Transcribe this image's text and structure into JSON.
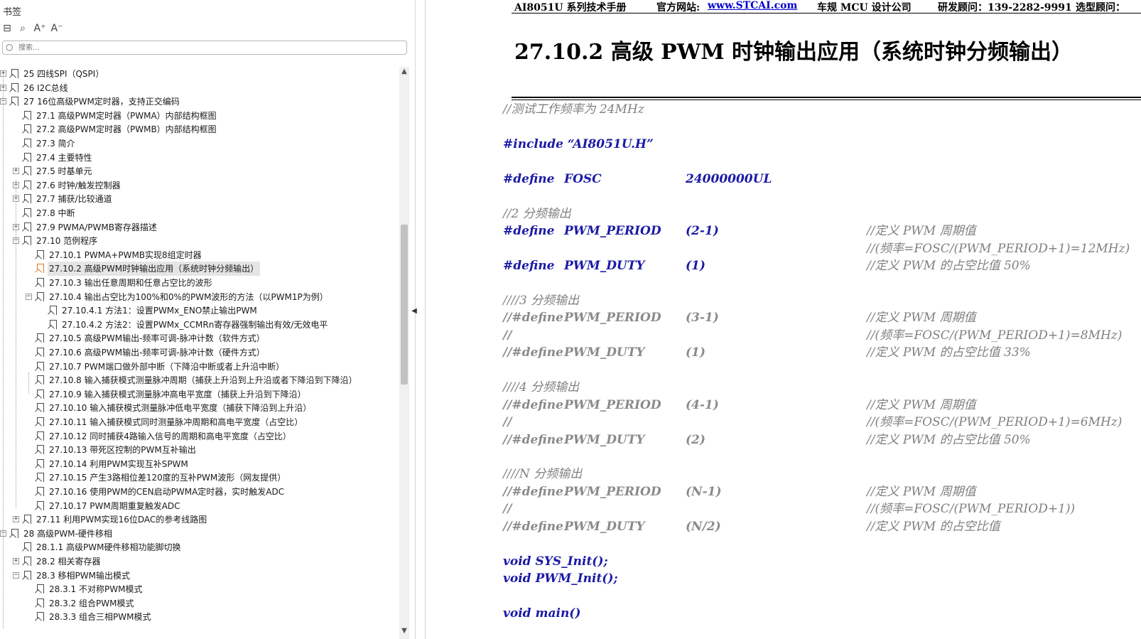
{
  "sidebar": {
    "title": "书签",
    "toolbar": {
      "icons": [
        "bookmark-list-icon",
        "bookmark-find-icon",
        "font-increase-icon",
        "font-decrease-icon"
      ],
      "glyphs": [
        "⊟",
        "⌕",
        "A⁺",
        "A⁻"
      ]
    },
    "search": {
      "placeholder": "搜索..."
    },
    "tree": [
      {
        "label": "25  四线SPI（QSPI）",
        "level": 0,
        "expander": "+"
      },
      {
        "label": "26  I2C总线",
        "level": 0,
        "expander": "+"
      },
      {
        "label": "27  16位高级PWM定时器，支持正交编码",
        "level": 0,
        "expander": "−"
      },
      {
        "label": "27.1  高级PWM定时器（PWMA）内部结构框图",
        "level": 1,
        "expander": ""
      },
      {
        "label": "27.2  高级PWM定时器（PWMB）内部结构框图",
        "level": 1,
        "expander": ""
      },
      {
        "label": "27.3  简介",
        "level": 1,
        "expander": ""
      },
      {
        "label": "27.4 主要特性",
        "level": 1,
        "expander": ""
      },
      {
        "label": "27.5  时基单元",
        "level": 1,
        "expander": "+"
      },
      {
        "label": "27.6  时钟/触发控制器",
        "level": 1,
        "expander": "+"
      },
      {
        "label": "27.7 捕获/比较通道",
        "level": 1,
        "expander": "+"
      },
      {
        "label": "27.8 中断",
        "level": 1,
        "expander": ""
      },
      {
        "label": "27.9  PWMA/PWMB寄存器描述",
        "level": 1,
        "expander": "+"
      },
      {
        "label": "27.10  范例程序",
        "level": 1,
        "expander": "−"
      },
      {
        "label": "27.10.1 PWMA+PWMB实现8组定时器",
        "level": 2,
        "expander": ""
      },
      {
        "label": "27.10.2 高级PWM时钟输出应用（系统时钟分频输出）",
        "level": 2,
        "expander": "",
        "selected": true
      },
      {
        "label": "27.10.3 输出任意周期和任意占空比的波形",
        "level": 2,
        "expander": ""
      },
      {
        "label": "27.10.4  输出占空比为100%和0%的PWM波形的方法（以PWM1P为例）",
        "level": 2,
        "expander": "−"
      },
      {
        "label": "27.10.4.1 方法1：设置PWMx_ENO禁止输出PWM",
        "level": 3,
        "expander": ""
      },
      {
        "label": "27.10.4.2 方法2：设置PWMx_CCMRn寄存器强制输出有效/无效电平",
        "level": 3,
        "expander": ""
      },
      {
        "label": "27.10.5 高级PWM输出-频率可调-脉冲计数（软件方式）",
        "level": 2,
        "expander": ""
      },
      {
        "label": "27.10.6 高级PWM输出-频率可调-脉冲计数（硬件方式）",
        "level": 2,
        "expander": ""
      },
      {
        "label": "27.10.7 PWM端口做外部中断（下降沿中断或者上升沿中断）",
        "level": 2,
        "expander": ""
      },
      {
        "label": "27.10.8 输入捕获模式测量脉冲周期（捕获上升沿到上升沿或者下降沿到下降沿）",
        "level": 2,
        "expander": ""
      },
      {
        "label": "27.10.9  输入捕获模式测量脉冲高电平宽度（捕获上升沿到下降沿）",
        "level": 2,
        "expander": ""
      },
      {
        "label": "27.10.10  输入捕获模式测量脉冲低电平宽度（捕获下降沿到上升沿）",
        "level": 2,
        "expander": ""
      },
      {
        "label": "27.10.11  输入捕获模式同时测量脉冲周期和高电平宽度（占空比）",
        "level": 2,
        "expander": ""
      },
      {
        "label": "27.10.12  同时捕获4路输入信号的周期和高电平宽度（占空比）",
        "level": 2,
        "expander": ""
      },
      {
        "label": "27.10.13 带死区控制的PWM互补输出",
        "level": 2,
        "expander": ""
      },
      {
        "label": "27.10.14 利用PWM实现互补SPWM",
        "level": 2,
        "expander": ""
      },
      {
        "label": "27.10.15  产生3路相位差120度的互补PWM波形（网友提供）",
        "level": 2,
        "expander": ""
      },
      {
        "label": "27.10.16 使用PWM的CEN启动PWMA定时器，实时触发ADC",
        "level": 2,
        "expander": ""
      },
      {
        "label": "27.10.17 PWM周期重复触发ADC",
        "level": 2,
        "expander": ""
      },
      {
        "label": "27.11 利用PWM实现16位DAC的参考线路图",
        "level": 1,
        "expander": "+"
      },
      {
        "label": "28  高级PWM-硬件移相",
        "level": 0,
        "expander": "−"
      },
      {
        "label": "28.1.1 高级PWM硬件移相功能脚切换",
        "level": 1,
        "expander": ""
      },
      {
        "label": "28.2  相关寄存器",
        "level": 1,
        "expander": "+"
      },
      {
        "label": "28.3  移相PWM输出模式",
        "level": 1,
        "expander": "−"
      },
      {
        "label": "28.3.1 不对称PWM模式",
        "level": 2,
        "expander": ""
      },
      {
        "label": "28.3.2  组合PWM模式",
        "level": 2,
        "expander": ""
      },
      {
        "label": "28.3.3  组合三相PWM模式",
        "level": 2,
        "expander": ""
      }
    ]
  },
  "document": {
    "header": {
      "manual": "AI8051U 系列技术手册",
      "site_label": "官方网站:",
      "site_url": "www.STCAI.com",
      "company": "车规 MCU 设计公司",
      "consultant": "研发顾问：139-2282-9991",
      "sales": "选型顾问："
    },
    "section_title": "27.10.2   高级 PWM 时钟输出应用（系统时钟分频输出）",
    "code": [
      {
        "style": "comment",
        "c1": "//测试工作频率为 24MHz",
        "c2": "",
        "c3": "",
        "c4": ""
      },
      {
        "style": "blank",
        "c1": "",
        "c2": "",
        "c3": "",
        "c4": ""
      },
      {
        "style": "kw",
        "c1": "#include “AI8051U.H”",
        "c2": "",
        "c3": "",
        "c4": ""
      },
      {
        "style": "blank",
        "c1": "",
        "c2": "",
        "c3": "",
        "c4": ""
      },
      {
        "style": "kw",
        "c1": "#define",
        "c2": "FOSC",
        "c3": "24000000UL",
        "c4": ""
      },
      {
        "style": "blank",
        "c1": "",
        "c2": "",
        "c3": "",
        "c4": ""
      },
      {
        "style": "comment",
        "c1": "//2 分频输出",
        "c2": "",
        "c3": "",
        "c4": ""
      },
      {
        "style": "kw",
        "c1": "#define",
        "c2": "PWM_PERIOD",
        "c3": "(2-1)",
        "c4": "//定义 PWM 周期值"
      },
      {
        "style": "kwc",
        "c1": "",
        "c2": "",
        "c3": "",
        "c4": "//(频率=FOSC/(PWM_PERIOD+1)=12MHz)"
      },
      {
        "style": "kw",
        "c1": "#define",
        "c2": "PWM_DUTY",
        "c3": "(1)",
        "c4": "//定义 PWM 的占空比值 50%"
      },
      {
        "style": "blank",
        "c1": "",
        "c2": "",
        "c3": "",
        "c4": ""
      },
      {
        "style": "comment",
        "c1": "////3 分频输出",
        "c2": "",
        "c3": "",
        "c4": ""
      },
      {
        "style": "dim",
        "c1": "//#define",
        "c2": "PWM_PERIOD",
        "c3": "(3-1)",
        "c4": "//定义 PWM 周期值"
      },
      {
        "style": "dim",
        "c1": "//",
        "c2": "",
        "c3": "",
        "c4": "//(频率=FOSC/(PWM_PERIOD+1)=8MHz)"
      },
      {
        "style": "dim",
        "c1": "//#define",
        "c2": "PWM_DUTY",
        "c3": "(1)",
        "c4": "//定义 PWM 的占空比值 33%"
      },
      {
        "style": "blank",
        "c1": "",
        "c2": "",
        "c3": "",
        "c4": ""
      },
      {
        "style": "comment",
        "c1": "////4 分频输出",
        "c2": "",
        "c3": "",
        "c4": ""
      },
      {
        "style": "dim",
        "c1": "//#define",
        "c2": "PWM_PERIOD",
        "c3": "(4-1)",
        "c4": "//定义 PWM 周期值"
      },
      {
        "style": "dim",
        "c1": "//",
        "c2": "",
        "c3": "",
        "c4": "//(频率=FOSC/(PWM_PERIOD+1)=6MHz)"
      },
      {
        "style": "dim",
        "c1": "//#define",
        "c2": "PWM_DUTY",
        "c3": "(2)",
        "c4": "//定义 PWM 的占空比值 50%"
      },
      {
        "style": "blank",
        "c1": "",
        "c2": "",
        "c3": "",
        "c4": ""
      },
      {
        "style": "comment",
        "c1": "////N 分频输出",
        "c2": "",
        "c3": "",
        "c4": ""
      },
      {
        "style": "dim",
        "c1": "//#define",
        "c2": "PWM_PERIOD",
        "c3": "(N-1)",
        "c4": "//定义 PWM 周期值"
      },
      {
        "style": "dim",
        "c1": "//",
        "c2": "",
        "c3": "",
        "c4": "//(频率=FOSC/(PWM_PERIOD+1))"
      },
      {
        "style": "dim",
        "c1": "//#define",
        "c2": "PWM_DUTY",
        "c3": "(N/2)",
        "c4": "//定义 PWM 的占空比值"
      },
      {
        "style": "blank",
        "c1": "",
        "c2": "",
        "c3": "",
        "c4": ""
      },
      {
        "style": "kw",
        "c1": "void SYS_Init();",
        "c2": "",
        "c3": "",
        "c4": ""
      },
      {
        "style": "kw",
        "c1": "void PWM_Init();",
        "c2": "",
        "c3": "",
        "c4": ""
      },
      {
        "style": "blank",
        "c1": "",
        "c2": "",
        "c3": "",
        "c4": ""
      },
      {
        "style": "kw",
        "c1": "void main()",
        "c2": "",
        "c3": "",
        "c4": ""
      }
    ]
  },
  "colors": {
    "keyword": "#1a1aa6",
    "comment": "#808080",
    "selection_bookmark": "#e07a1f",
    "url": "#0000cc"
  }
}
